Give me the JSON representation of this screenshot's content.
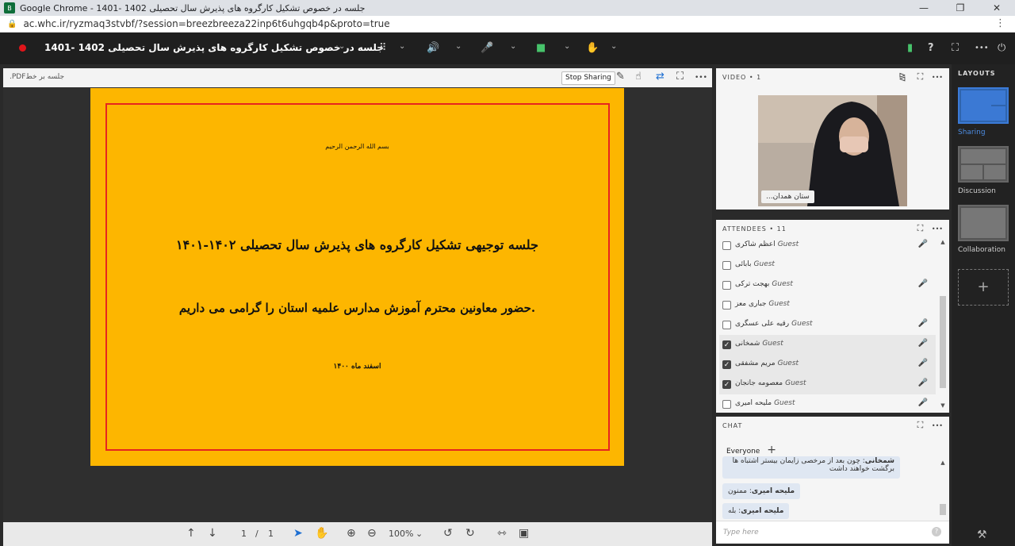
{
  "browser": {
    "window_title": "Google Chrome - 1401- 1402 جلسه در خصوص تشکیل کارگروه های پذیرش سال تحصیلی",
    "url": "ac.whc.ir/ryzmaq3stvbf/?session=breezbreeza22inp6t6uhgqb4p&proto=true",
    "app_icon_text": "B",
    "win_controls": [
      "—",
      "❐",
      "✕"
    ],
    "more": "⋮"
  },
  "toolbar": {
    "meeting_title": "جلسه در خصوص تشکیل کارگروه های پذیرش سال تحصیلی 1402 -1401",
    "title_chevron": "⌄",
    "apps_glyph": "⠿",
    "speaker_glyph": "🔊",
    "mic_glyph": "🎤",
    "camera_glyph": "■",
    "hand_glyph": "✋",
    "chevron": "⌄",
    "signal_glyph": "▮",
    "help_glyph": "?",
    "fullscreen_glyph": "⛶",
    "more_glyph": "•••",
    "power_glyph": "⏻"
  },
  "share": {
    "file_name": ".PDFجلسه بر خط",
    "stop_sharing": "Stop Sharing",
    "tools": [
      "✎",
      "☝",
      "⇄",
      "⛶",
      "•••"
    ]
  },
  "slide": {
    "basmala": "بسم الله الرحمن الرحیم",
    "headline": "جلسه توجیهی تشکیل کارگروه های پذیرش سال تحصیلی ۱۴۰۲-۱۴۰۱",
    "subline": "حضور معاونین محترم آموزش مدارس علمیه استان را گرامی می داریم.",
    "date": "اسفند ماه ۱۴۰۰"
  },
  "viewer": {
    "up": "↑",
    "down": "↓",
    "page": "1",
    "sep": "/",
    "total": "1",
    "pointer": "➤",
    "hand": "✋",
    "zoom_in": "⊕",
    "zoom_out": "⊖",
    "zoom": "100%",
    "chev": "⌄",
    "rotate_left": "↺",
    "rotate_right": "↻",
    "fit_w": "⇿",
    "fit_p": "▣"
  },
  "video": {
    "header": "VIDEO • 1",
    "actions": [
      "⧎",
      "⛶",
      "•••"
    ],
    "participant_name": "...ستان همدان"
  },
  "attendees": {
    "header": "ATTENDEES • 11",
    "actions": [
      "⛶",
      "•••"
    ],
    "rows": [
      {
        "name": "اعظم شاکری",
        "role": "Guest",
        "checked": false,
        "mic": "🎤"
      },
      {
        "name": "بابائی",
        "role": "Guest",
        "checked": false,
        "mic": ""
      },
      {
        "name": "بهجت ترکی",
        "role": "Guest",
        "checked": false,
        "mic": "🎤"
      },
      {
        "name": "جباری معز",
        "role": "Guest",
        "checked": false,
        "mic": ""
      },
      {
        "name": "رقیه علی عسگری",
        "role": "Guest",
        "checked": false,
        "mic": "🎤"
      },
      {
        "name": "شمخانی",
        "role": "Guest",
        "checked": true,
        "mic": "🎤"
      },
      {
        "name": "مریم مشفقی",
        "role": "Guest",
        "checked": true,
        "mic": "🎤"
      },
      {
        "name": "معصومه جانجان",
        "role": "Guest",
        "checked": true,
        "mic": "🎤"
      },
      {
        "name": "ملیحه امیری",
        "role": "Guest",
        "checked": false,
        "mic": "🎤"
      }
    ],
    "scroll_up": "▲",
    "scroll_down": "▼"
  },
  "chat": {
    "header": "CHAT",
    "actions": [
      "⛶",
      "•••"
    ],
    "tab": "Everyone",
    "tab_plus": "+",
    "messages": [
      {
        "sender": "شمخانی",
        "text": "چون بعد از مرخصی زایمان بیستر اشتباه ها برگشت خواهند داشت"
      },
      {
        "sender": "ملیحه امیری",
        "text": "ممنون"
      },
      {
        "sender": "ملیحه امیری",
        "text": "بله"
      }
    ],
    "placeholder": "Type here",
    "scroll_up": "▲",
    "help_glyph": "?"
  },
  "layouts": {
    "header": "LAYOUTS",
    "items": [
      "Sharing",
      "Discussion",
      "Collaboration"
    ],
    "add": "+",
    "footer_glyph": "⚒"
  },
  "colors": {
    "accent": "#3b7bd8",
    "record": "#e0151a",
    "slide_bg": "#fdb600",
    "slide_border": "#e6251f",
    "green": "#47c36b"
  }
}
